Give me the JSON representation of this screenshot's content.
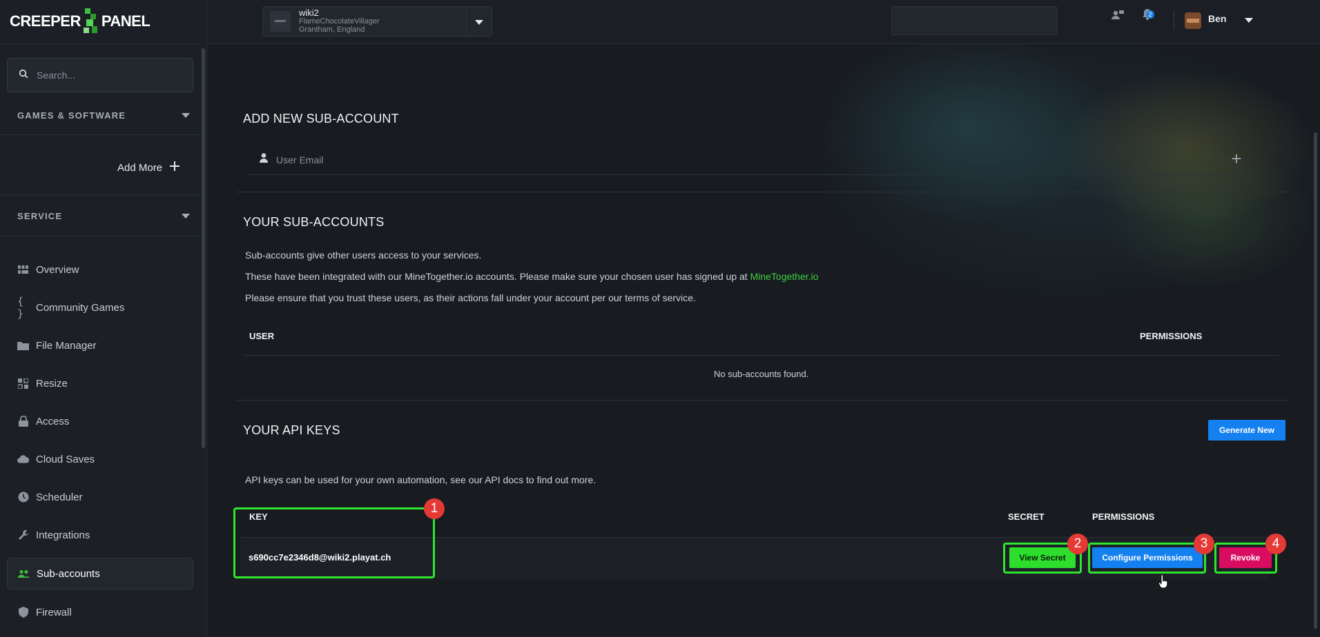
{
  "brand": {
    "logo_text_left": "CREEPER",
    "logo_text_right": "PANEL",
    "accent": "#3fbf3f"
  },
  "sidebar": {
    "search_placeholder": "Search...",
    "games_section": "GAMES & SOFTWARE",
    "add_more": "Add More",
    "service_section": "SERVICE",
    "items": [
      {
        "label": "Overview",
        "icon": "grid-icon"
      },
      {
        "label": "Community Games",
        "icon": "braces-icon"
      },
      {
        "label": "File Manager",
        "icon": "folder-icon"
      },
      {
        "label": "Resize",
        "icon": "resize-icon"
      },
      {
        "label": "Access",
        "icon": "lock-icon"
      },
      {
        "label": "Cloud Saves",
        "icon": "cloud-icon"
      },
      {
        "label": "Scheduler",
        "icon": "clock-icon"
      },
      {
        "label": "Integrations",
        "icon": "wrench-icon"
      },
      {
        "label": "Sub-accounts",
        "icon": "users-icon",
        "active": true
      },
      {
        "label": "Firewall",
        "icon": "shield-icon"
      }
    ]
  },
  "topbar": {
    "server_name": "wiki2",
    "server_host": "FlameChocolateVillager",
    "server_location": "Grantham, England",
    "notification_count": "2",
    "user_name": "Ben"
  },
  "add_subaccount": {
    "title": "ADD NEW SUB-ACCOUNT",
    "email_placeholder": "User Email",
    "add_symbol": "+"
  },
  "subaccounts": {
    "title": "YOUR SUB-ACCOUNTS",
    "line1": "Sub-accounts give other users access to your services.",
    "line2_prefix": "These have been integrated with our MineTogether.io accounts. Please make sure your chosen user has signed up at ",
    "line2_link": "MineTogether.io",
    "line3": "Please ensure that you trust these users, as their actions fall under your account per our terms of service.",
    "col_user": "USER",
    "col_permissions": "PERMISSIONS",
    "empty": "No sub-accounts found."
  },
  "api_keys": {
    "title": "YOUR API KEYS",
    "generate_button": "Generate New",
    "description": "API keys can be used for your own automation, see our API docs to find out more.",
    "col_key": "KEY",
    "col_secret": "SECRET",
    "col_permissions": "PERMISSIONS",
    "rows": [
      {
        "key": "s690cc7e2346d8@wiki2.playat.ch",
        "view_secret": "View Secret",
        "configure": "Configure Permissions",
        "revoke": "Revoke"
      }
    ]
  },
  "annotations": {
    "m1": "1",
    "m2": "2",
    "m3": "3",
    "m4": "4",
    "highlight_color": "#2ee62e",
    "marker_color": "#e53935"
  }
}
